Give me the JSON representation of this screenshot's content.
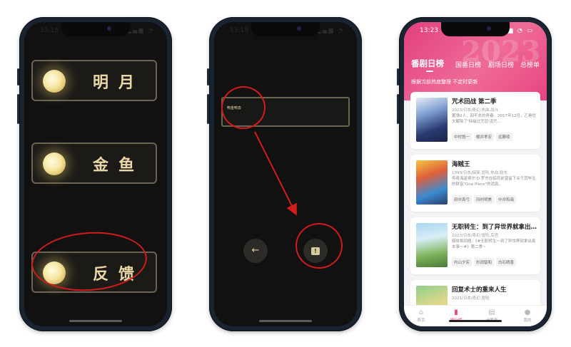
{
  "phones": {
    "left": {
      "status_time": "13:15",
      "items": [
        {
          "label": "明月",
          "icon": "moon-icon"
        },
        {
          "label": "金鱼",
          "icon": "moon-icon"
        },
        {
          "label": "反馈",
          "icon": "moon-icon"
        }
      ]
    },
    "middle": {
      "status_time": "13:15",
      "input_text": "鸭金鸭去",
      "back_icon": "←",
      "feedback_icon": "!"
    },
    "right": {
      "status_time": "13:23",
      "tabs": [
        "番剧日榜",
        "国番日榜",
        "剧场日榜",
        "总榜单"
      ],
      "subtitle": "根据当前热度整理 不定时更新",
      "cards": [
        {
          "title": "咒术回战 第二季",
          "meta": "2023/日本/奇幻,热血,战斗",
          "desc": "蓄强2人，回不去的青春。2017年12月，乙骨忧太解除了'特级过咒怨'诅咒...",
          "tags": [
            "中村悠一",
            "樱井孝宏",
            "远藤绫"
          ]
        },
        {
          "title": "海贼王",
          "meta": "1999/日本/搞笑,冒险,热血,励志",
          "desc": "传奇海盗哥尔·D·罗杰在临死前曾留下关于其毕生的财富\"One Piece\"的消息。",
          "tags": [
            "田中真弓",
            "冈村明美",
            "中井和哉"
          ]
        },
        {
          "title": "无职转生：到了异世界就拿出真本事",
          "meta": "2023/日本/奇幻,冒险,后宫",
          "desc": "媒体相同题。《#无职转生～到了异世界就拿出真本事～#》第二季~",
          "tags": [
            "内山夕实",
            "杉田智和",
            "白石晴香"
          ]
        },
        {
          "title": "回复术士的重来人生",
          "meta": "2021/日本/奇幻,冒险",
          "desc": "",
          "tags": []
        }
      ],
      "tabbar": [
        {
          "label": "首页",
          "icon": "⌂"
        },
        {
          "label": "排行榜",
          "icon": "▮"
        },
        {
          "label": "追番表",
          "icon": "▤"
        },
        {
          "label": "我的",
          "icon": "●"
        }
      ]
    }
  },
  "colors": {
    "accent_pink": "#e8457f",
    "gold": "#e9d7a8",
    "annotation_red": "#d11c1c"
  }
}
